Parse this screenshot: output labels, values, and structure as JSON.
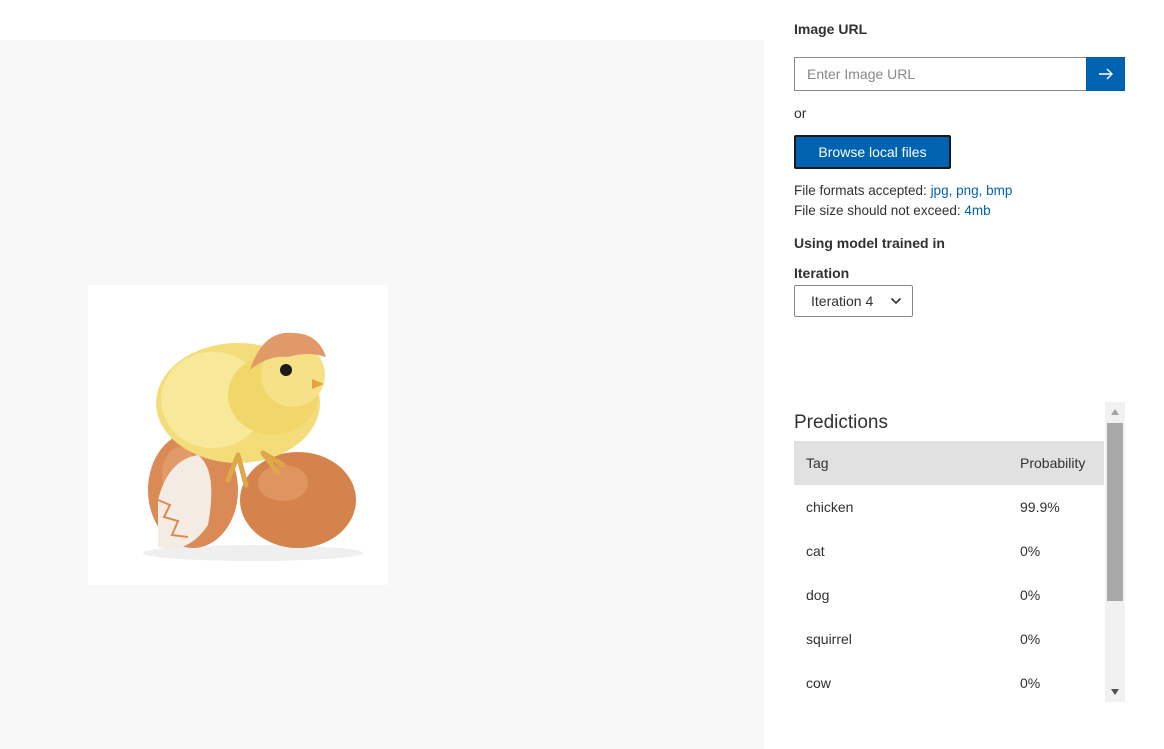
{
  "upload": {
    "url_label": "Image URL",
    "url_placeholder": "Enter Image URL",
    "or_text": "or",
    "browse_label": "Browse local files",
    "formats_prefix": "File formats accepted: ",
    "formats_value": "jpg, png, bmp",
    "size_prefix": "File size should not exceed: ",
    "size_value": "4mb"
  },
  "model": {
    "heading": "Using model trained in",
    "iteration_label": "Iteration",
    "iteration_value": "Iteration 4"
  },
  "predictions": {
    "title": "Predictions",
    "columns": [
      "Tag",
      "Probability"
    ],
    "rows": [
      {
        "tag": "chicken",
        "probability": "99.9%"
      },
      {
        "tag": "cat",
        "probability": "0%"
      },
      {
        "tag": "dog",
        "probability": "0%"
      },
      {
        "tag": "squirrel",
        "probability": "0%"
      },
      {
        "tag": "cow",
        "probability": "0%"
      }
    ]
  },
  "icons": {
    "submit": "arrow-right-icon",
    "dropdown": "chevron-down-icon",
    "scroll_up": "triangle-up-icon",
    "scroll_down": "triangle-down-icon"
  },
  "colors": {
    "accent": "#0063b1",
    "preview_bg": "#f8f8f8",
    "header_row": "#e1e1e1"
  }
}
